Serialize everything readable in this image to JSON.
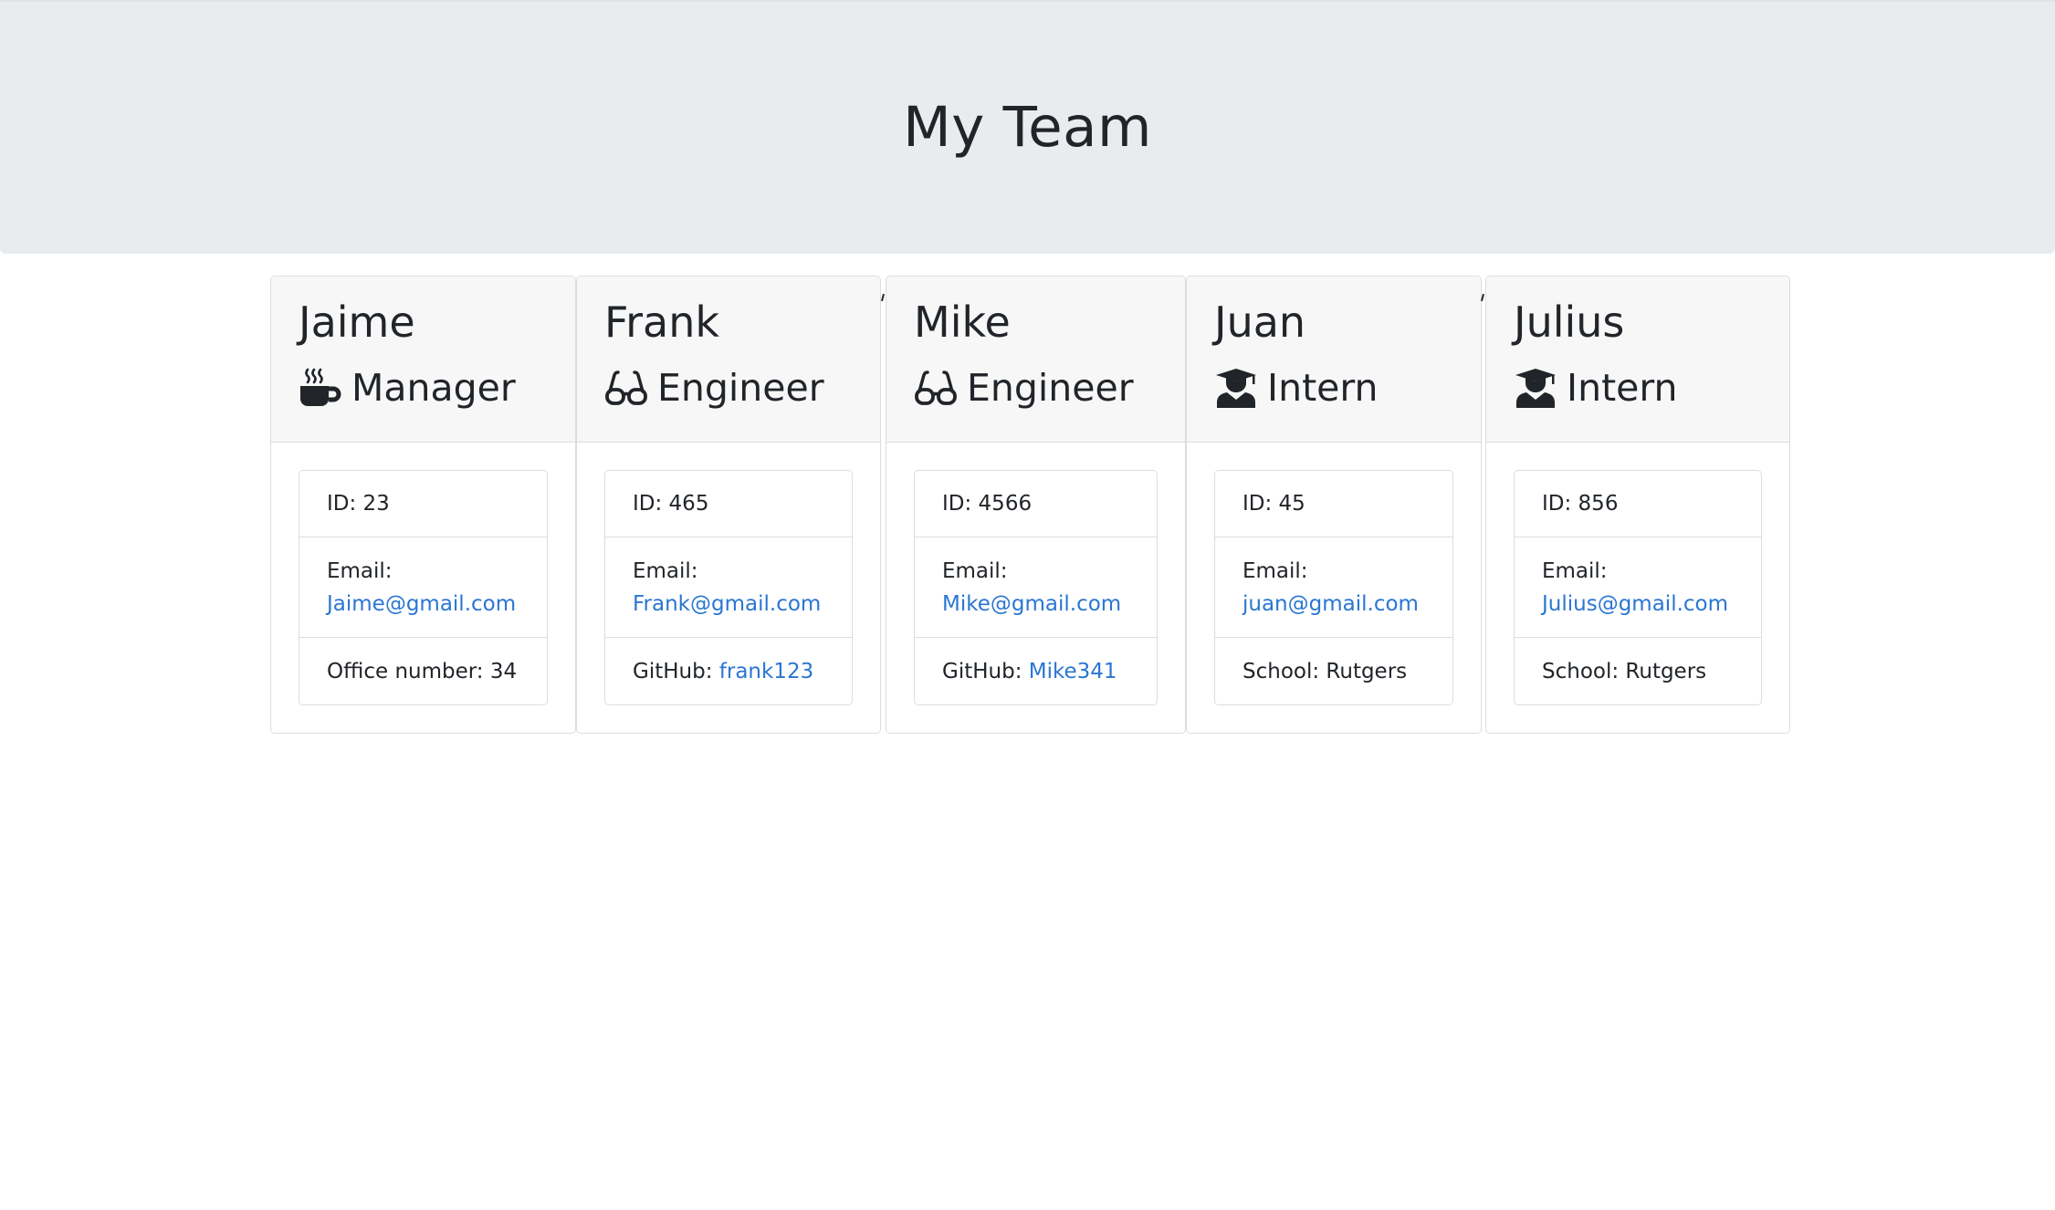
{
  "page": {
    "title": "My Team"
  },
  "colors": {
    "jumbotron_bg": "#e9ecef",
    "card_header_bg": "#f7f7f7",
    "link": "#2a76d2",
    "text": "#212529"
  },
  "team": [
    {
      "name": "Jaime",
      "role": "Manager",
      "role_icon": "mug-hot-icon",
      "id_label": "ID: 23",
      "email_label": "Email:",
      "email": "Jaime@gmail.com",
      "extra_label": "Office number: 34",
      "extra_link": ""
    },
    {
      "name": "Frank",
      "role": "Engineer",
      "role_icon": "glasses-icon",
      "id_label": "ID: 465",
      "email_label": "Email:",
      "email": "Frank@gmail.com",
      "extra_label": "GitHub: ",
      "extra_link": "frank123"
    },
    {
      "name": "Mike",
      "role": "Engineer",
      "role_icon": "glasses-icon",
      "id_label": "ID: 4566",
      "email_label": "Email:",
      "email": "Mike@gmail.com",
      "extra_label": "GitHub: ",
      "extra_link": "Mike341"
    },
    {
      "name": "Juan",
      "role": "Intern",
      "role_icon": "graduate-icon",
      "id_label": "ID: 45",
      "email_label": "Email:",
      "email": "juan@gmail.com",
      "extra_label": "School: Rutgers",
      "extra_link": ""
    },
    {
      "name": "Julius",
      "role": "Intern",
      "role_icon": "graduate-icon",
      "id_label": "ID: 856",
      "email_label": "Email:",
      "email": "Julius@gmail.com",
      "extra_label": "School: Rutgers",
      "extra_link": ""
    }
  ]
}
